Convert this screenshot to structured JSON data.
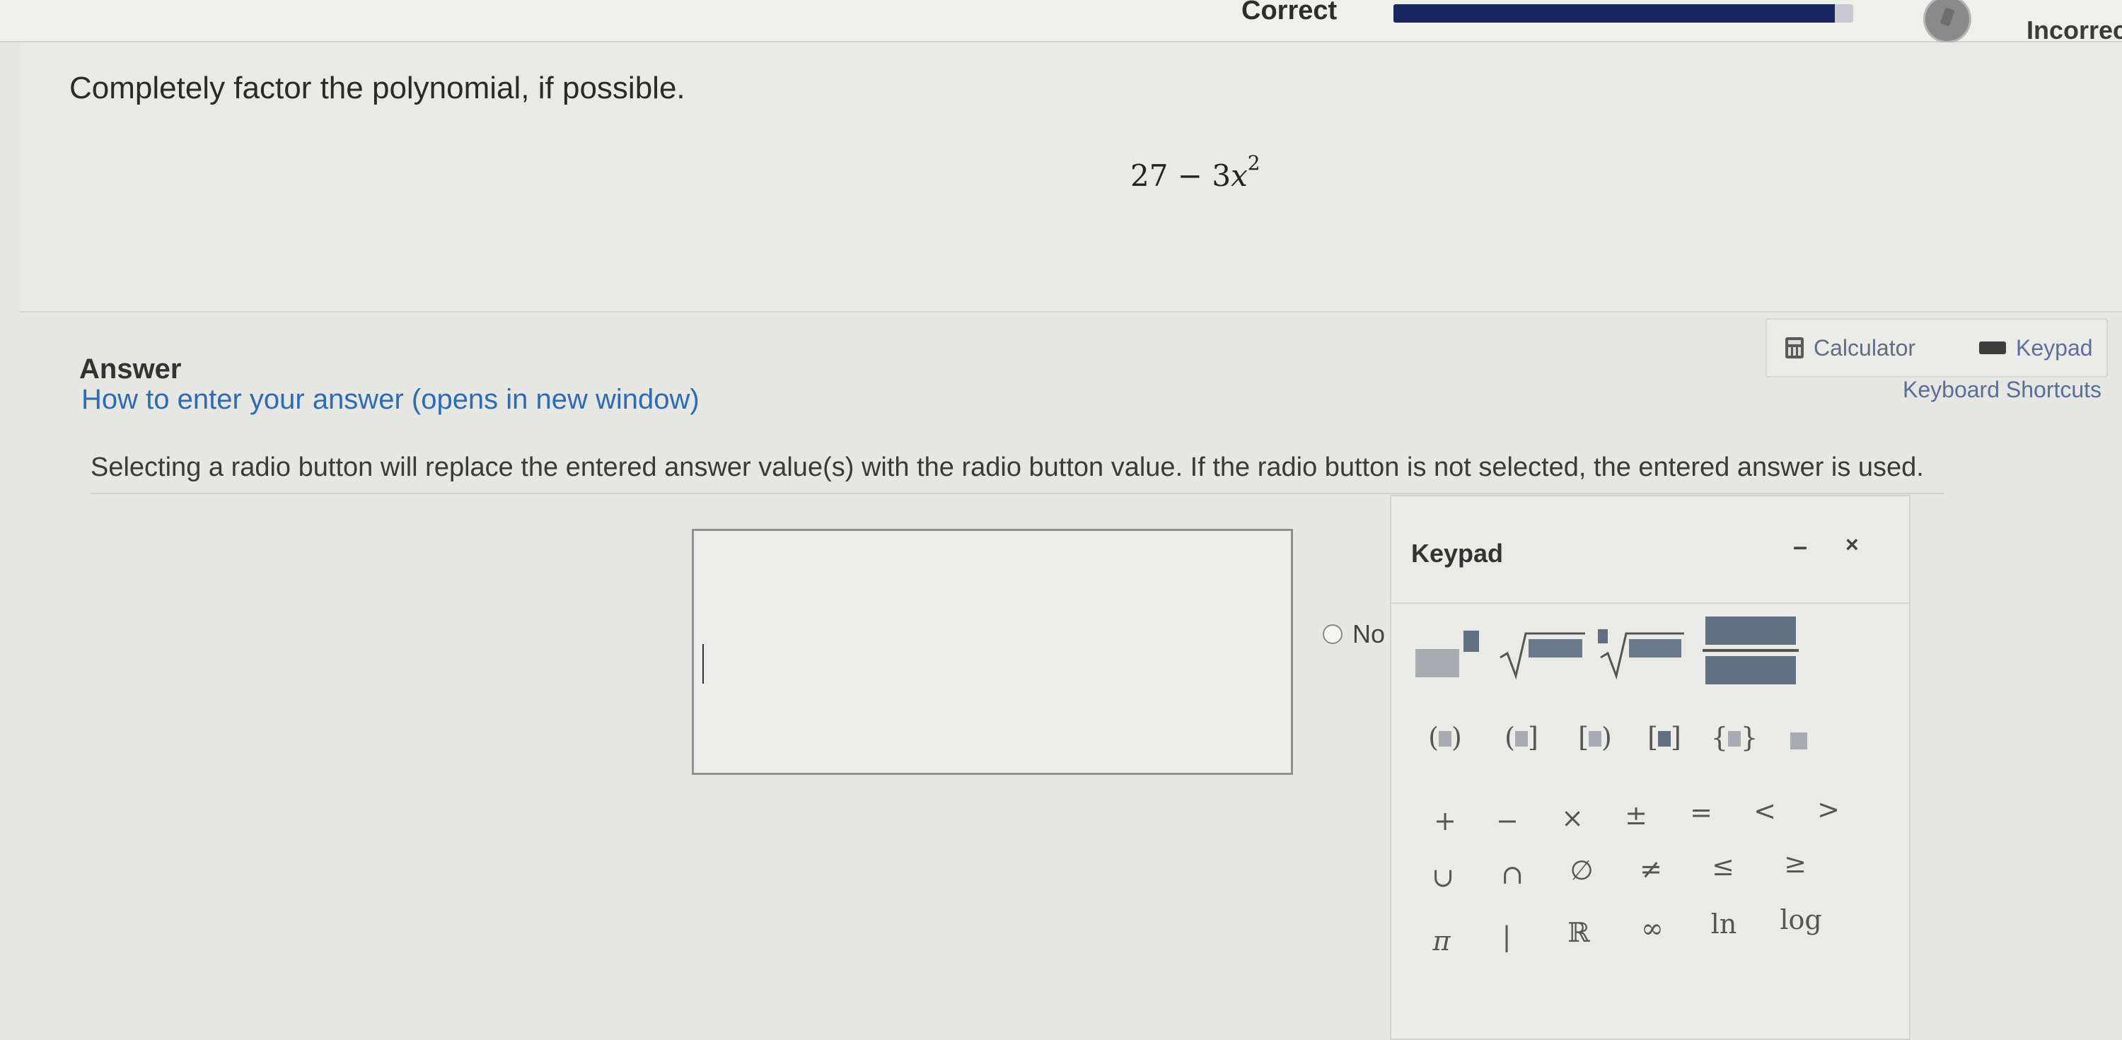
{
  "header": {
    "correct_label": "Correct",
    "incorrect_label": "Incorrect",
    "progress_fraction": 0.96
  },
  "question": {
    "prompt": "Completely factor the polynomial, if possible.",
    "polynomial_base": "27 − 3",
    "polynomial_var": "x",
    "polynomial_exp": "2"
  },
  "answer": {
    "title": "Answer",
    "how_to_link": "How to enter your answer (opens in new window)",
    "calculator_label": "Calculator",
    "keypad_label": "Keypad",
    "shortcuts_label": "Keyboard Shortcuts",
    "instructions": "Selecting a radio button will replace the entered answer value(s) with the radio button value. If the radio button is not selected, the entered answer is used.",
    "input_value": "",
    "radio_label": "No"
  },
  "keypad": {
    "title": "Keypad",
    "minimize": "–",
    "close": "×",
    "row_operators": [
      "+",
      "−",
      "×",
      "±",
      "=",
      "<",
      ">"
    ],
    "row_sets": [
      "∪",
      "∩",
      "∅",
      "≠",
      "≤",
      "≥"
    ],
    "row_constants": [
      "π",
      "|",
      "ℝ",
      "∞",
      "ln",
      "log"
    ],
    "icons": {
      "calculator": "calculator-icon",
      "keypad": "keyboard-icon",
      "streak": "streak-icon"
    }
  },
  "colors": {
    "progress_fill": "#1a2660",
    "link": "#2d6bb5"
  }
}
